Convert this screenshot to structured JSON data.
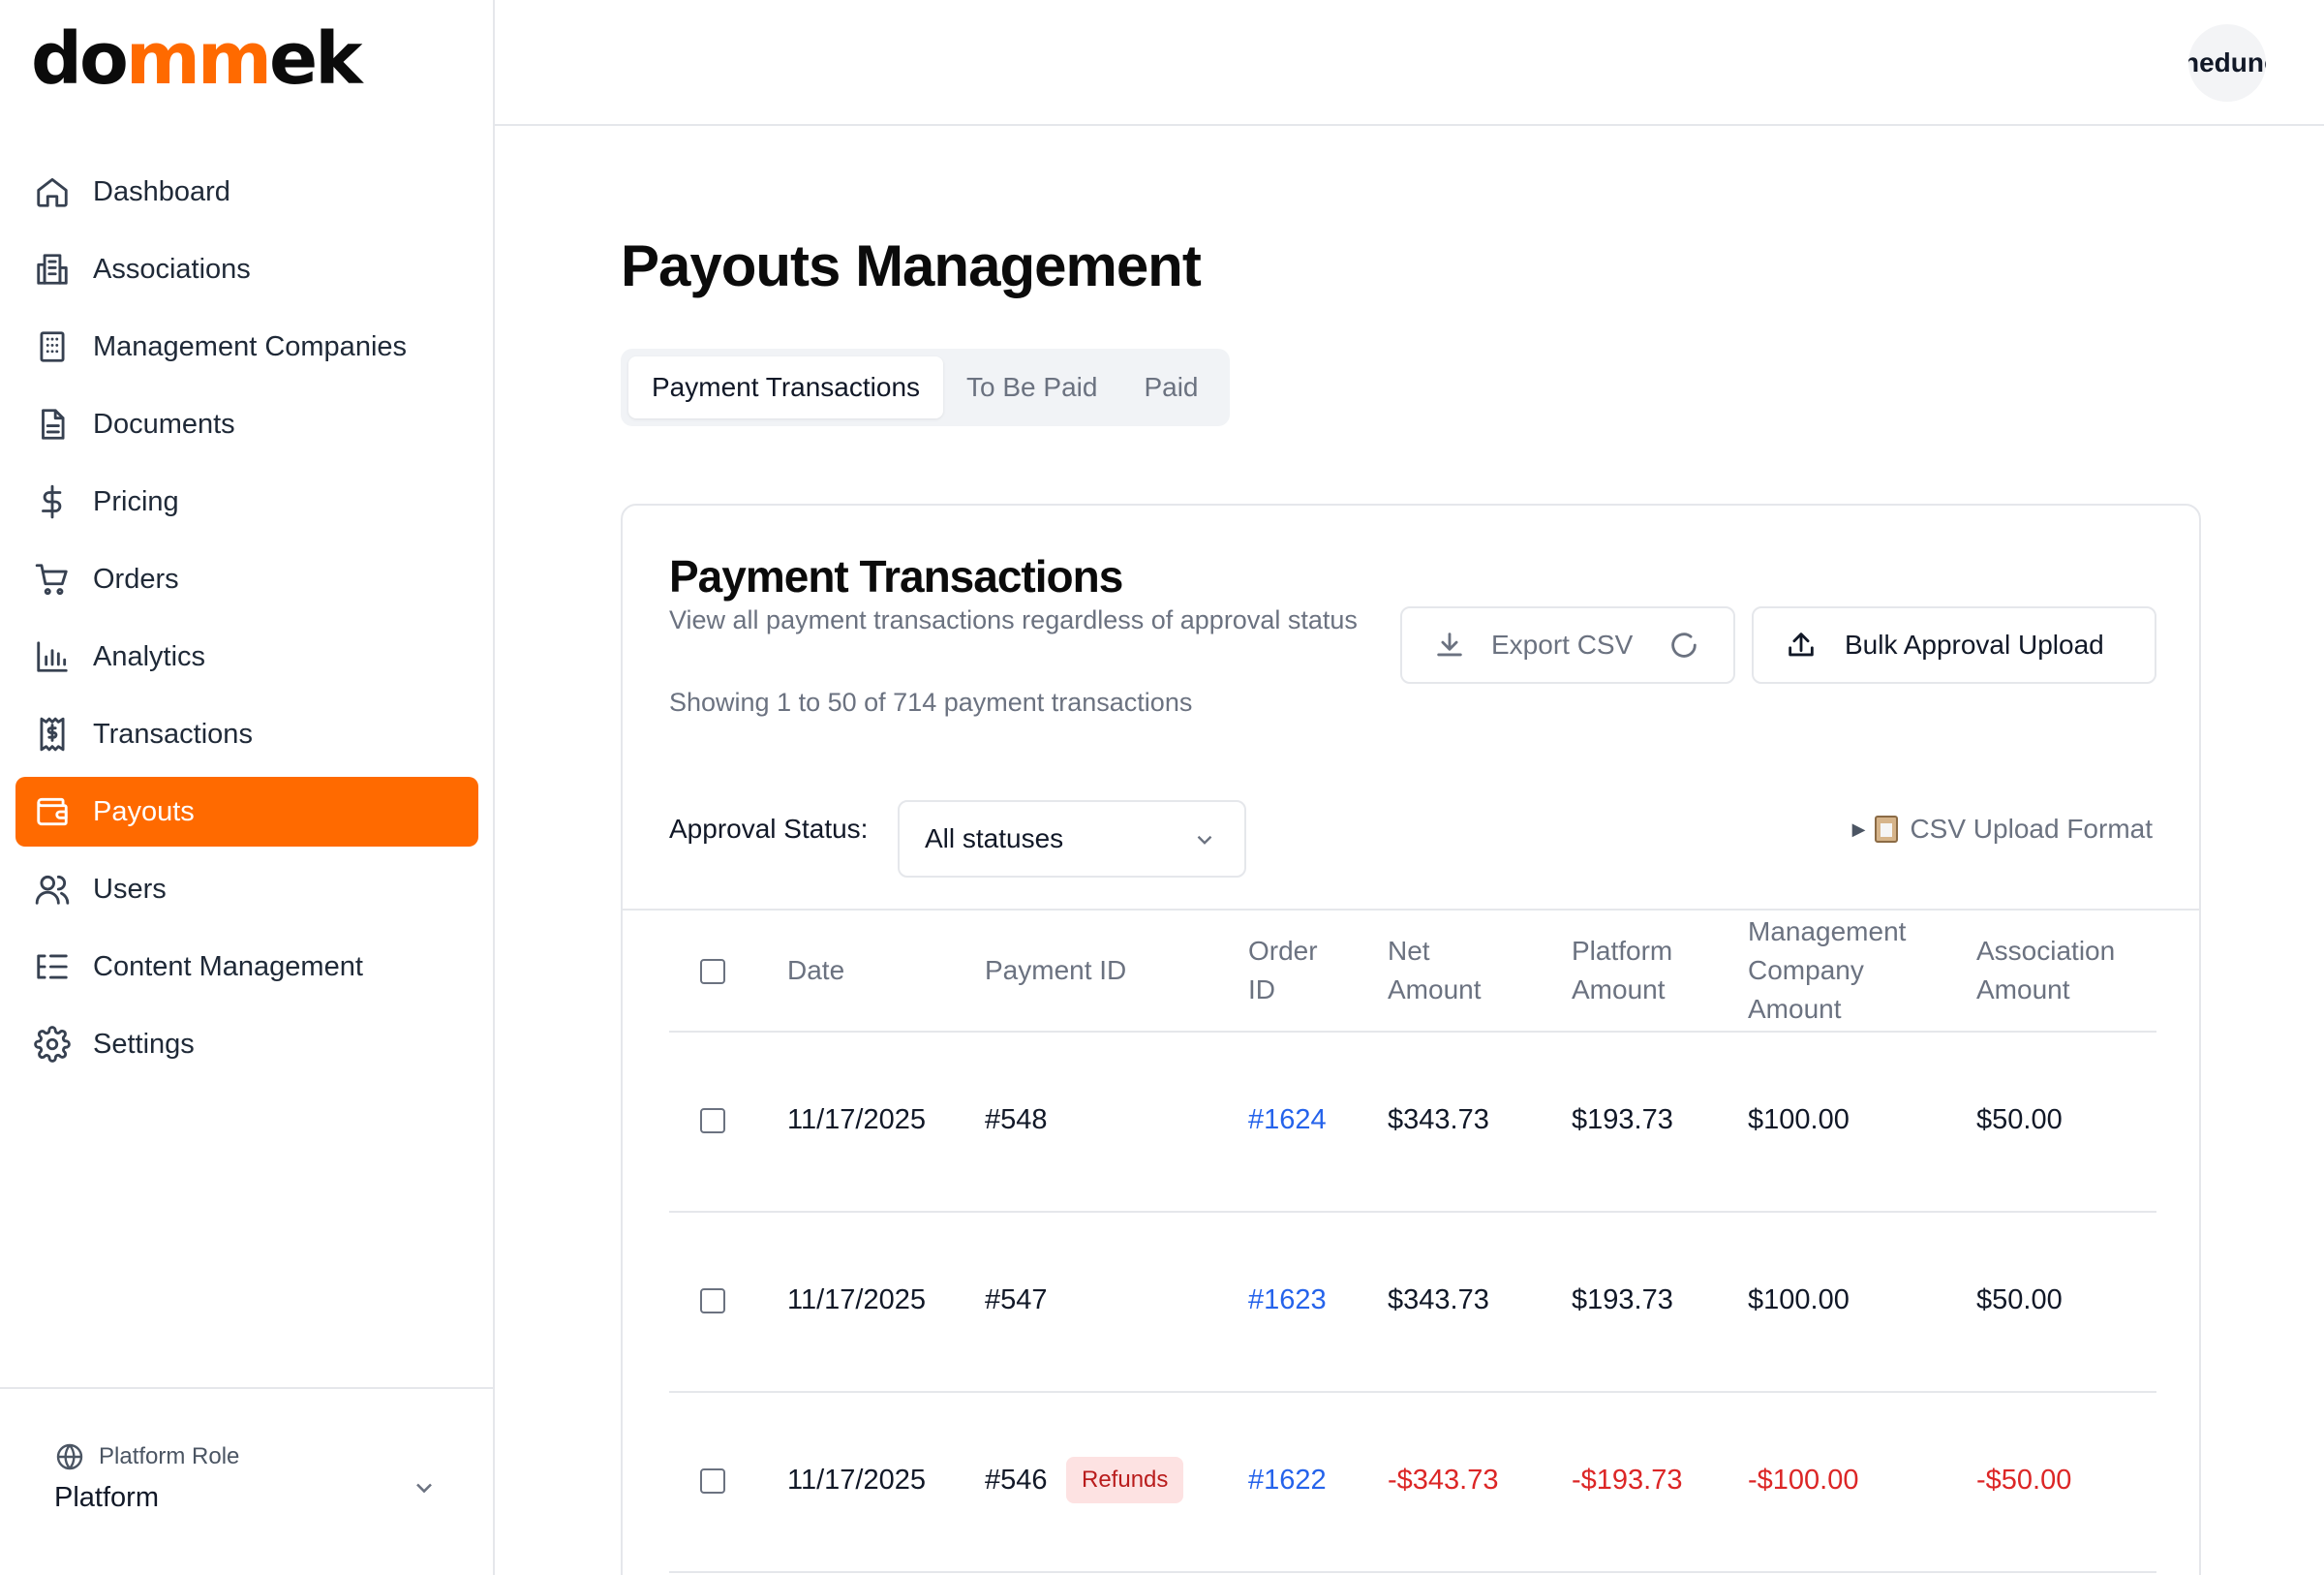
{
  "brand": {
    "logo_prefix": "do",
    "logo_accent": "mm",
    "logo_suffix": "ek"
  },
  "sidebar": {
    "items": [
      {
        "label": "Dashboard",
        "icon": "home-icon"
      },
      {
        "label": "Associations",
        "icon": "building-icon"
      },
      {
        "label": "Management Companies",
        "icon": "office-building-icon"
      },
      {
        "label": "Documents",
        "icon": "document-icon"
      },
      {
        "label": "Pricing",
        "icon": "dollar-icon"
      },
      {
        "label": "Orders",
        "icon": "cart-icon"
      },
      {
        "label": "Analytics",
        "icon": "bar-chart-icon"
      },
      {
        "label": "Transactions",
        "icon": "receipt-icon"
      },
      {
        "label": "Payouts",
        "icon": "wallet-icon",
        "active": true
      },
      {
        "label": "Users",
        "icon": "users-icon"
      },
      {
        "label": "Content Management",
        "icon": "list-icon"
      },
      {
        "label": "Settings",
        "icon": "gear-icon"
      }
    ],
    "footer": {
      "role_label": "Platform Role",
      "role_value": "Platform"
    }
  },
  "header": {
    "avatar_text": "nedunc"
  },
  "main": {
    "title": "Payouts Management",
    "tabs": [
      {
        "label": "Payment Transactions",
        "active": true
      },
      {
        "label": "To Be Paid"
      },
      {
        "label": "Paid"
      }
    ],
    "card": {
      "title": "Payment Transactions",
      "description": "View all payment transactions regardless of approval status",
      "count_text": "Showing 1 to 50 of 714 payment transactions",
      "export_label": "Export CSV",
      "bulk_label": "Bulk Approval Upload",
      "filter_label": "Approval Status:",
      "filter_value": "All statuses",
      "csv_format_label": "CSV Upload Format"
    },
    "table": {
      "headers": {
        "date": "Date",
        "payment_id": "Payment ID",
        "order_id_1": "Order",
        "order_id_2": "ID",
        "net_1": "Net",
        "net_2": "Amount",
        "platform_1": "Platform",
        "platform_2": "Amount",
        "mgmt_1": "Management",
        "mgmt_2": "Company",
        "mgmt_3": "Amount",
        "assoc_1": "Association",
        "assoc_2": "Amount"
      },
      "rows": [
        {
          "date": "11/17/2025",
          "payment_id": "#548",
          "order_id": "#1624",
          "net": "$343.73",
          "platform": "$193.73",
          "mgmt": "$100.00",
          "assoc": "$50.00"
        },
        {
          "date": "11/17/2025",
          "payment_id": "#547",
          "order_id": "#1623",
          "net": "$343.73",
          "platform": "$193.73",
          "mgmt": "$100.00",
          "assoc": "$50.00"
        },
        {
          "date": "11/17/2025",
          "payment_id": "#546",
          "badge": "Refunds",
          "order_id": "#1622",
          "net": "-$343.73",
          "platform": "-$193.73",
          "mgmt": "-$100.00",
          "assoc": "-$50.00"
        }
      ]
    }
  },
  "colors": {
    "accent": "#ff6a00",
    "link": "#2563eb",
    "negative": "#dc2626",
    "badge_bg": "#fde2e2"
  }
}
